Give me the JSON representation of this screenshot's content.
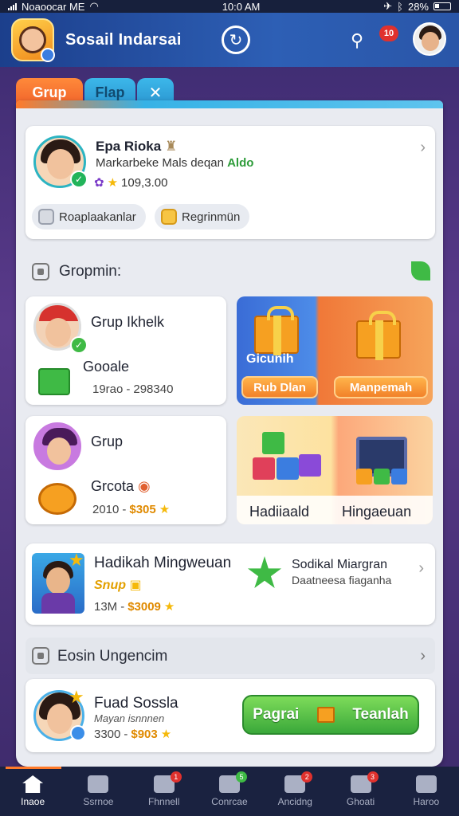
{
  "status_bar": {
    "carrier": "Noaoocar ME",
    "time": "10:0 AM",
    "battery": "28%"
  },
  "header": {
    "title": "Sosail Indarsai",
    "notification_count": "10"
  },
  "tabs": [
    {
      "label": "Grup"
    },
    {
      "label": "Flap"
    },
    {
      "label": "✕"
    }
  ],
  "profile": {
    "name": "Epa Rioka",
    "subtitle": "Markarbeke Mals deqan",
    "subtitle_highlight": "Aldo",
    "coins": "109,3.00",
    "buttons": [
      {
        "label": "Roaplaakanlar"
      },
      {
        "label": "Regrinmün"
      }
    ]
  },
  "group_section": {
    "title": "Gropmin:"
  },
  "groups": [
    {
      "title": "Grup Ikhelk",
      "item": "Gooale",
      "meta_a": "19rao",
      "meta_b": "298340"
    },
    {
      "title": "Grup",
      "item": "Grcota",
      "meta_a": "2010",
      "meta_b": "$305"
    }
  ],
  "rewards": {
    "tile1": {
      "label": "Gicunih",
      "button_a": "Rub Dlan",
      "button_b": "Manpemah"
    },
    "tile2": {
      "label_a": "Hadiiaald",
      "label_b": "Hingaeuan"
    }
  },
  "weekly": {
    "title": "Hadikah Mingweuan",
    "tag": "Snup",
    "meta_a": "13M",
    "meta_b": "$3009",
    "right_title": "Sodikal Miargran",
    "right_sub": "Daatneesa fiaganha"
  },
  "event_section": {
    "title": "Eosin Ungencim"
  },
  "event": {
    "name": "Fuad Sossla",
    "sub": "Mayan isnnnen",
    "meta_a": "3300",
    "meta_b": "$903",
    "button_left": "Pagrai",
    "button_right": "Teanlah"
  },
  "bottom_nav": [
    {
      "label": "Inaoe"
    },
    {
      "label": "Ssrnoe"
    },
    {
      "label": "Fhnnell",
      "badge": "1"
    },
    {
      "label": "Conrcae",
      "badge": "5"
    },
    {
      "label": "Ancidng",
      "badge": "2"
    },
    {
      "label": "Ghoati",
      "badge": "3"
    },
    {
      "label": "Haroo"
    }
  ],
  "colors": {
    "accent": "#ff7a2a",
    "primary": "#2d5fb5",
    "success": "#3fba45"
  }
}
